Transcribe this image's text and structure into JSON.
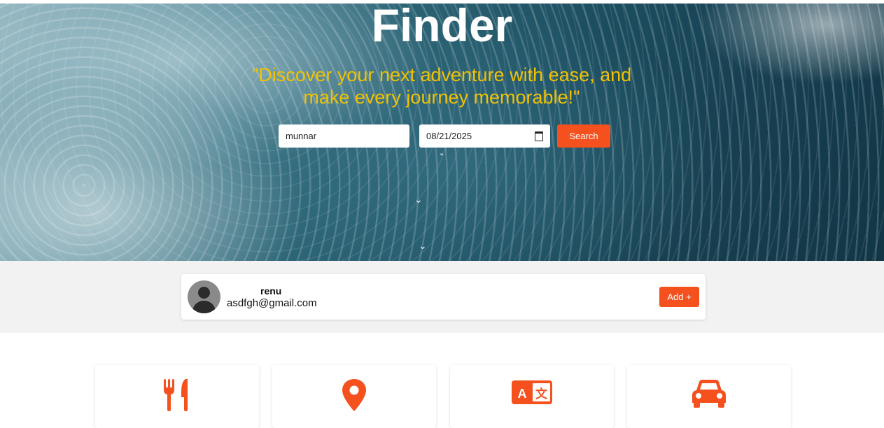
{
  "hero": {
    "title": "Finder",
    "tagline": "\"Discover your next adventure with ease, and make every journey memorable!\"",
    "quote_mark": "\""
  },
  "search": {
    "destination_value": "munnar",
    "date_value": "08/21/2025",
    "button_label": "Search"
  },
  "profile": {
    "name": "renu",
    "email": "asdfgh@gmail.com",
    "add_button_label": "Add +"
  },
  "features": [
    {
      "icon": "utensils-icon"
    },
    {
      "icon": "location-pin-icon"
    },
    {
      "icon": "translate-icon"
    },
    {
      "icon": "car-icon"
    }
  ],
  "colors": {
    "accent": "#f4511e",
    "tagline": "#f2c200",
    "band": "#f2f2f2"
  }
}
